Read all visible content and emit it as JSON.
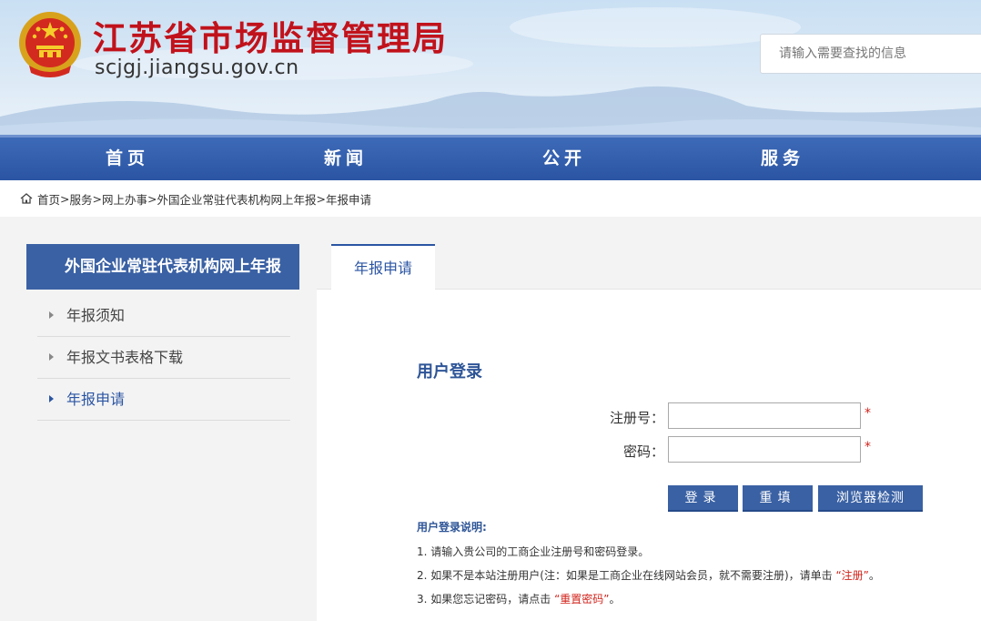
{
  "header": {
    "title": "江苏省市场监督管理局",
    "domain": "scjgj.jiangsu.gov.cn",
    "search_placeholder": "请输入需要查找的信息"
  },
  "nav": {
    "items": [
      {
        "label": "首页"
      },
      {
        "label": "新闻"
      },
      {
        "label": "公开"
      },
      {
        "label": "服务"
      }
    ]
  },
  "breadcrumb": {
    "items": [
      "首页",
      "服务",
      "网上办事",
      "外国企业常驻代表机构网上年报",
      "年报申请"
    ],
    "separator": ">"
  },
  "sidebar": {
    "title": "外国企业常驻代表机构网上年报",
    "items": [
      {
        "label": "年报须知",
        "active": false
      },
      {
        "label": "年报文书表格下载",
        "active": false
      },
      {
        "label": "年报申请",
        "active": true
      }
    ]
  },
  "main": {
    "tab_label": "年报申请",
    "login_title": "用户登录",
    "fields": {
      "reg_label": "注册号：",
      "reg_value": "",
      "pwd_label": "密码：",
      "pwd_value": "",
      "required_mark": "*"
    },
    "buttons": {
      "login": "登录",
      "reset": "重填",
      "check": "浏览器检测"
    },
    "notes_title": "用户登录说明:",
    "notes": [
      {
        "text": "1. 请输入贵公司的工商企业注册号和密码登录。",
        "link": "",
        "suffix": ""
      },
      {
        "text": "2. 如果不是本站注册用户(注：如果是工商企业在线网站会员，就不需要注册)，请单击",
        "link": "“注册”",
        "suffix": "。"
      },
      {
        "text": "3. 如果您忘记密码，请点击",
        "link": "“重置密码”",
        "suffix": "。"
      }
    ]
  },
  "colors": {
    "brand_red": "#c1121b",
    "nav_blue": "#2b55a3",
    "panel_blue": "#3a61a4",
    "link_red": "#d1241c"
  }
}
